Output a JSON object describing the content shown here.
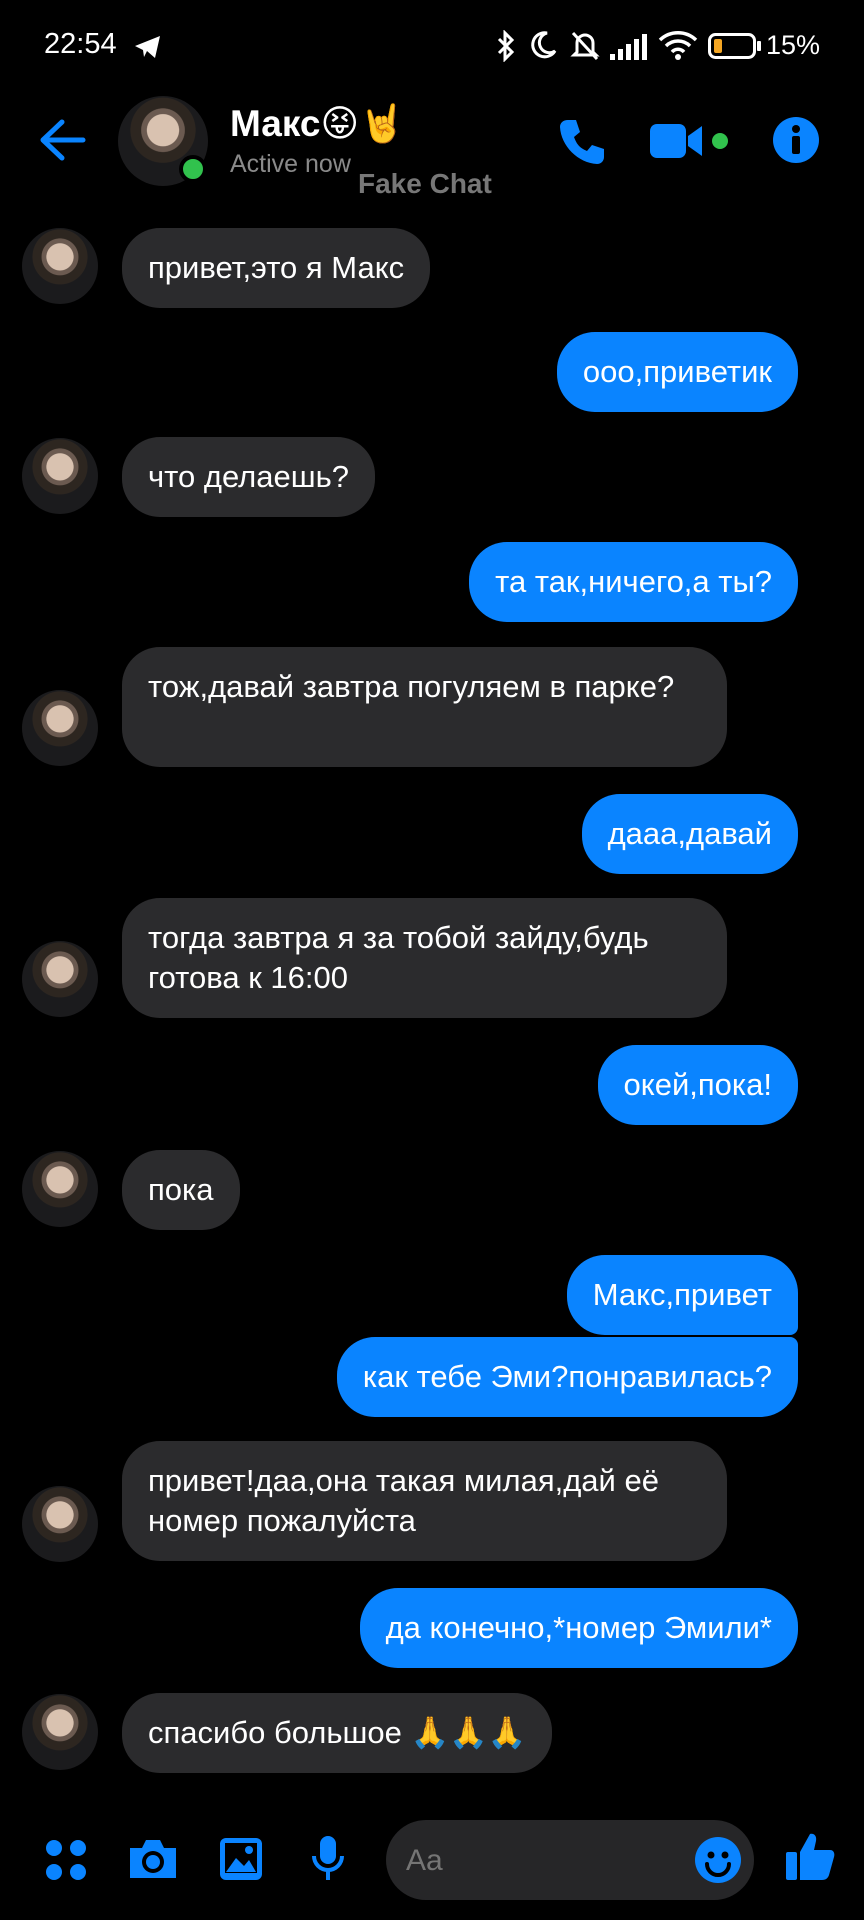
{
  "status_bar": {
    "time": "22:54",
    "battery_percent": "15%",
    "icons": [
      "telegram-icon",
      "bluetooth-icon",
      "moon-icon",
      "bell-off-icon",
      "signal-icon",
      "wifi-icon",
      "battery-icon"
    ]
  },
  "header": {
    "contact_name": "Макс😝🤘",
    "status": "Active now",
    "watermark": "Fake Chat"
  },
  "messages": [
    {
      "dir": "in",
      "text": "привет,это я Макс"
    },
    {
      "dir": "out",
      "text": "ооо,приветик"
    },
    {
      "dir": "in",
      "text": "что делаешь?"
    },
    {
      "dir": "out",
      "text": "та так,ничего,а ты?"
    },
    {
      "dir": "in",
      "text": "тож,давай завтра погуляем в парке?"
    },
    {
      "dir": "out",
      "text": "дааа,давай"
    },
    {
      "dir": "in",
      "text": "тогда завтра я за тобой зайду,будь готова к 16:00"
    },
    {
      "dir": "out",
      "text": "окей,пока!"
    },
    {
      "dir": "in",
      "text": "пока"
    },
    {
      "dir": "out",
      "text": "Макс,привет"
    },
    {
      "dir": "out",
      "text": "как тебе Эми?понравилась?"
    },
    {
      "dir": "in",
      "text": "привет!даа,она такая милая,дай её номер пожалуйста"
    },
    {
      "dir": "out",
      "text": "да конечно,*номер Эмили*"
    },
    {
      "dir": "in",
      "text": "спасибо большое 🙏🙏🙏"
    }
  ],
  "composer": {
    "placeholder": "Aa"
  },
  "colors": {
    "accent": "#0a84ff",
    "incoming_bubble": "#2b2b2d",
    "active": "#31c24d",
    "battery_low": "#f5a623"
  }
}
